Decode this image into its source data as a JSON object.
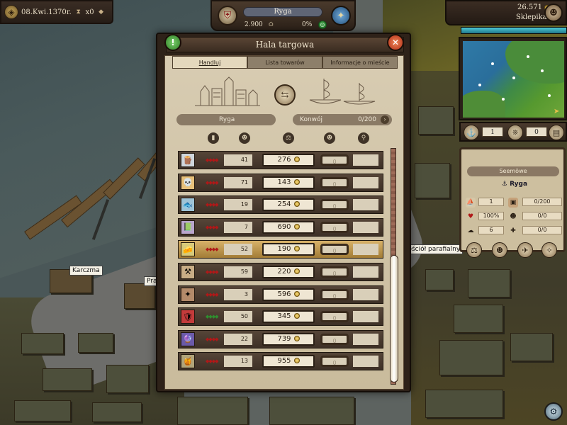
{
  "top_left": {
    "date": "08.Kwi.1370r.",
    "multiplier": "x0"
  },
  "city_panel": {
    "name": "Ryga",
    "population": "2.900",
    "satisfaction": "0%"
  },
  "top_right": {
    "money": "26.571",
    "rank": "Sklepikarz"
  },
  "hud": {
    "ships_count": "1",
    "crews_count": "0"
  },
  "convoy_panel": {
    "title": "Seemöwe",
    "location": "Ryga",
    "rows": [
      {
        "left": "1",
        "right": "0/200"
      },
      {
        "left": "100%",
        "right": "0/0"
      },
      {
        "left": "6",
        "right": "0/0"
      }
    ]
  },
  "map_labels": {
    "tavern": "Karczma",
    "workshop": "Prac",
    "church": "Kościół parafialny"
  },
  "window": {
    "title": "Hala targowa",
    "tabs": [
      {
        "label": "Handluj",
        "active": true
      },
      {
        "label": "Lista towarów",
        "active": false
      },
      {
        "label": "Informacje o mieście",
        "active": false
      }
    ],
    "city_banner": "Ryga",
    "convoy_banner": "Konwój",
    "convoy_capacity": "0/200"
  },
  "goods": [
    {
      "icon": "🪵",
      "stock": "41",
      "price": "276",
      "convoy": "0",
      "level": "red",
      "bg": "#cfd6dc"
    },
    {
      "icon": "💀",
      "stock": "71",
      "price": "143",
      "convoy": "0",
      "level": "red",
      "bg": "#e7c07a"
    },
    {
      "icon": "🐟",
      "stock": "19",
      "price": "254",
      "convoy": "0",
      "level": "red",
      "bg": "#9fc3d6"
    },
    {
      "icon": "📗",
      "stock": "7",
      "price": "690",
      "convoy": "0",
      "level": "red",
      "bg": "#b9a5cc"
    },
    {
      "icon": "🧀",
      "stock": "52",
      "price": "190",
      "convoy": "0",
      "level": "red",
      "bg": "#d8ca7a",
      "selected": true
    },
    {
      "icon": "⚒",
      "stock": "59",
      "price": "220",
      "convoy": "0",
      "level": "red",
      "bg": "#c9ad86"
    },
    {
      "icon": "✦",
      "stock": "3",
      "price": "596",
      "convoy": "0",
      "level": "red",
      "bg": "#b38a6a"
    },
    {
      "icon": "🛡",
      "stock": "50",
      "price": "345",
      "convoy": "0",
      "level": "green",
      "bg": "#c33b3b"
    },
    {
      "icon": "🔮",
      "stock": "22",
      "price": "739",
      "convoy": "0",
      "level": "red",
      "bg": "#6b5aa8"
    },
    {
      "icon": "🍯",
      "stock": "13",
      "price": "955",
      "convoy": "0",
      "level": "red",
      "bg": "#b1a47a"
    }
  ],
  "colors": {
    "red_dots": "#b01818",
    "green_dots": "#2f8f2f",
    "selected_row": "#d8b26a"
  }
}
